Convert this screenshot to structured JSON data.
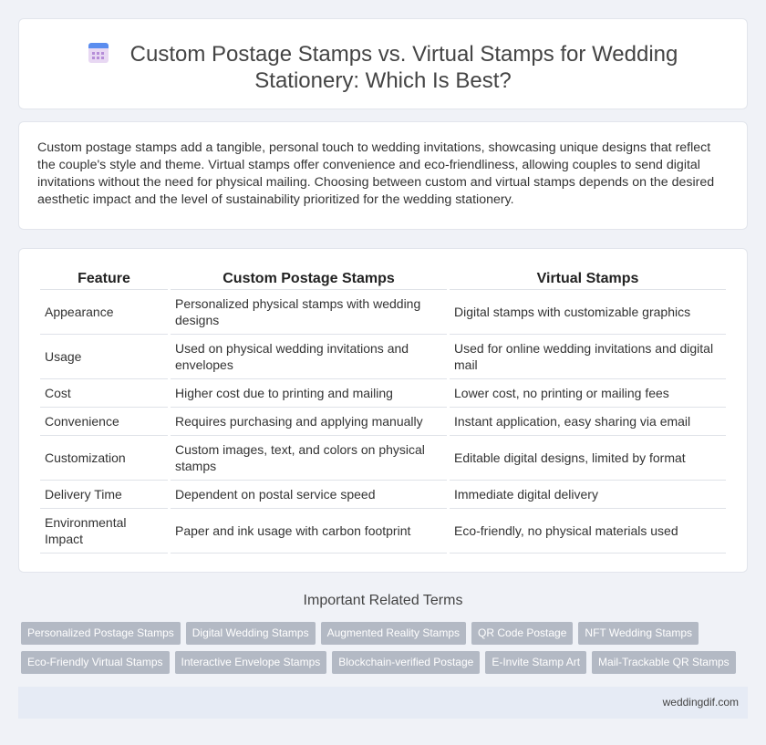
{
  "header": {
    "title_line1": "Custom Postage Stamps vs. Virtual Stamps for Wedding",
    "title_line2": "Stationery: Which Is Best?",
    "icon": "calendar-icon"
  },
  "intro": {
    "text": "Custom postage stamps add a tangible, personal touch to wedding invitations, showcasing unique designs that reflect the couple's style and theme. Virtual stamps offer convenience and eco-friendliness, allowing couples to send digital invitations without the need for physical mailing. Choosing between custom and virtual stamps depends on the desired aesthetic impact and the level of sustainability prioritized for the wedding stationery."
  },
  "table": {
    "headers": [
      "Feature",
      "Custom Postage Stamps",
      "Virtual Stamps"
    ],
    "rows": [
      [
        "Appearance",
        "Personalized physical stamps with wedding designs",
        "Digital stamps with customizable graphics"
      ],
      [
        "Usage",
        "Used on physical wedding invitations and envelopes",
        "Used for online wedding invitations and digital mail"
      ],
      [
        "Cost",
        "Higher cost due to printing and mailing",
        "Lower cost, no printing or mailing fees"
      ],
      [
        "Convenience",
        "Requires purchasing and applying manually",
        "Instant application, easy sharing via email"
      ],
      [
        "Customization",
        "Custom images, text, and colors on physical stamps",
        "Editable digital designs, limited by format"
      ],
      [
        "Delivery Time",
        "Dependent on postal service speed",
        "Immediate digital delivery"
      ],
      [
        "Environmental Impact",
        "Paper and ink usage with carbon footprint",
        "Eco-friendly, no physical materials used"
      ]
    ]
  },
  "related": {
    "title": "Important Related Terms",
    "row1": [
      "Personalized Postage Stamps",
      "Digital Wedding Stamps",
      "Augmented Reality Stamps",
      "QR Code Postage",
      "NFT Wedding Stamps"
    ],
    "row2": [
      "Eco-Friendly Virtual Stamps",
      "Interactive Envelope Stamps",
      "Blockchain-verified Postage",
      "E-Invite Stamp Art",
      "Mail-Trackable QR Stamps"
    ]
  },
  "footer": {
    "site": "weddingdif.com"
  }
}
